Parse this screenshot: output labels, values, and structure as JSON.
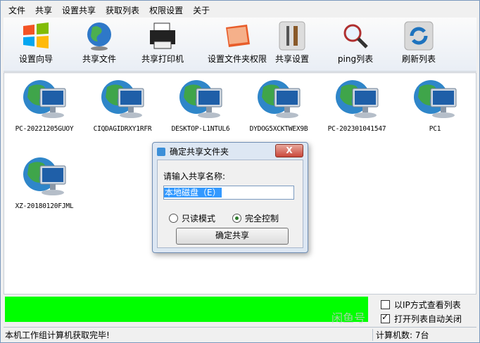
{
  "menu": [
    "文件",
    "共享",
    "设置共享",
    "获取列表",
    "权限设置",
    "关于"
  ],
  "toolbar": [
    {
      "label": "设置向导",
      "icon": "windows-logo-icon"
    },
    {
      "label": "共享文件",
      "icon": "globe-icon"
    },
    {
      "label": "共享打印机",
      "icon": "printer-icon"
    },
    {
      "label": "设置文件夹权限",
      "icon": "folder-icon"
    },
    {
      "label": "共享设置",
      "icon": "tools-icon"
    },
    {
      "label": "ping列表",
      "icon": "magnifier-icon"
    },
    {
      "label": "刷新列表",
      "icon": "refresh-icon"
    }
  ],
  "computers": [
    "PC-20221205GUOY",
    "CIQDAGIDRXY1RFR",
    "DESKTOP-L1NTUL6",
    "DYDOG5XCKTWEX9B",
    "PC-202301041547",
    "PC1",
    "XZ-20180120FJML"
  ],
  "dialog": {
    "title": "确定共享文件夹",
    "close": "X",
    "prompt": "请输入共享名称:",
    "value": "本地磁盘（E）",
    "radio_readonly": "只读模式",
    "radio_full": "完全控制",
    "selected": "full",
    "ok": "确定共享"
  },
  "options": {
    "by_ip": "以IP方式查看列表",
    "by_ip_checked": false,
    "auto_close": "打开列表自动关闭",
    "auto_close_checked": true
  },
  "status": {
    "left": "本机工作组计算机获取完毕!",
    "right": "计算机数: 7台"
  },
  "watermark": "闲鱼号"
}
